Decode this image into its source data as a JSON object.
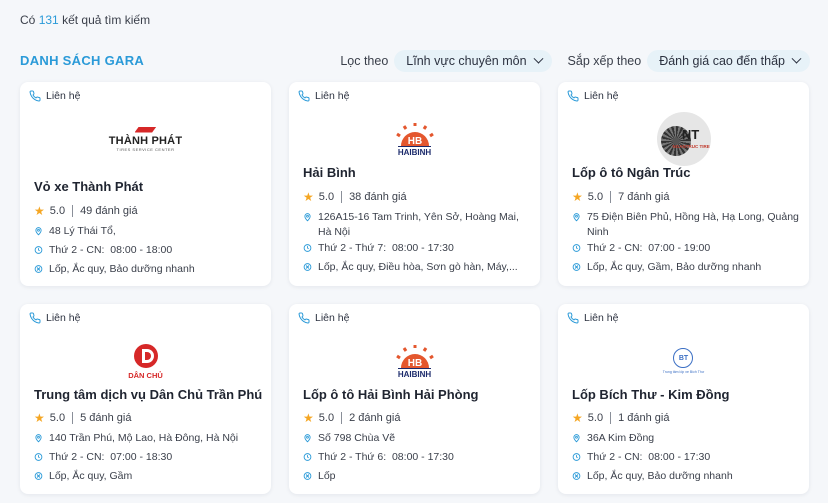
{
  "summary": {
    "prefix": "Có",
    "count": "131",
    "suffix": "kết quả tìm kiếm"
  },
  "list_title": "DANH SÁCH GARA",
  "filter": {
    "label": "Lọc theo",
    "value": "Lĩnh vực chuyên môn"
  },
  "sort": {
    "label": "Sắp xếp theo",
    "value": "Đánh giá cao đến thấp"
  },
  "contact_label": "Liên hệ",
  "colors": {
    "accent": "#2a9ad8",
    "star": "#f5a623",
    "pill_bg": "#e7f2f8"
  },
  "cards": [
    {
      "logo": "thanh-phat-logo",
      "logo_text": "THÀNH PHÁT",
      "logo_sub": "TIRES SERVICE CENTER",
      "name": "Vỏ xe Thành Phát",
      "rating": "5.0",
      "reviews": "49 đánh giá",
      "address": "48 Lý Thái Tổ,",
      "hours": "Thứ 2 - CN:  08:00 - 18:00",
      "services": "Lốp, Ắc quy, Bảo dưỡng nhanh"
    },
    {
      "logo": "hai-binh-logo",
      "logo_text": "HAIBINH",
      "name": "Hải Bình",
      "rating": "5.0",
      "reviews": "38 đánh giá",
      "address": "126A15-16 Tam Trinh, Yên Sở, Hoàng Mai, Hà Nội",
      "hours": "Thứ 2 - Thứ 7:  08:00 - 17:30",
      "services": "Lốp, Ắc quy, Điều hòa, Sơn gò hàn, Máy,..."
    },
    {
      "logo": "ngan-truc-logo",
      "logo_text": "NGANTRUC TIRE",
      "logo_mark": "NT",
      "name": "Lốp ô tô Ngân Trúc",
      "rating": "5.0",
      "reviews": "7 đánh giá",
      "address": "75 Điện Biên Phủ, Hồng Hà, Hạ Long, Quảng Ninh",
      "hours": "Thứ 2 - CN:  07:00 - 19:00",
      "services": "Lốp, Ắc quy, Gầm, Bảo dưỡng nhanh"
    },
    {
      "logo": "dan-chu-logo",
      "logo_text": "DÂN CHỦ",
      "name": "Trung tâm dịch vụ Dân Chủ Trần Phú",
      "rating": "5.0",
      "reviews": "5 đánh giá",
      "address": "140 Trần Phú, Mộ Lao, Hà Đông, Hà Nội",
      "hours": "Thứ 2 - CN:  07:00 - 18:30",
      "services": "Lốp, Ắc quy, Gầm"
    },
    {
      "logo": "hai-binh-logo",
      "logo_text": "HAIBINH",
      "name": "Lốp ô tô Hải Bình Hải Phòng",
      "rating": "5.0",
      "reviews": "2 đánh giá",
      "address": "Số 798 Chùa Vẽ",
      "hours": "Thứ 2 - Thứ 6:  08:00 - 17:30",
      "services": "Lốp"
    },
    {
      "logo": "bich-thu-logo",
      "logo_mark": "BT",
      "logo_text": "Trung tâm lốp xe Bích Thư",
      "name": "Lốp Bích Thư - Kim Đồng",
      "rating": "5.0",
      "reviews": "1 đánh giá",
      "address": "36A Kim Đồng",
      "hours": "Thứ 2 - CN:  08:00 - 17:30",
      "services": "Lốp, Ắc quy, Bảo dưỡng nhanh"
    }
  ]
}
